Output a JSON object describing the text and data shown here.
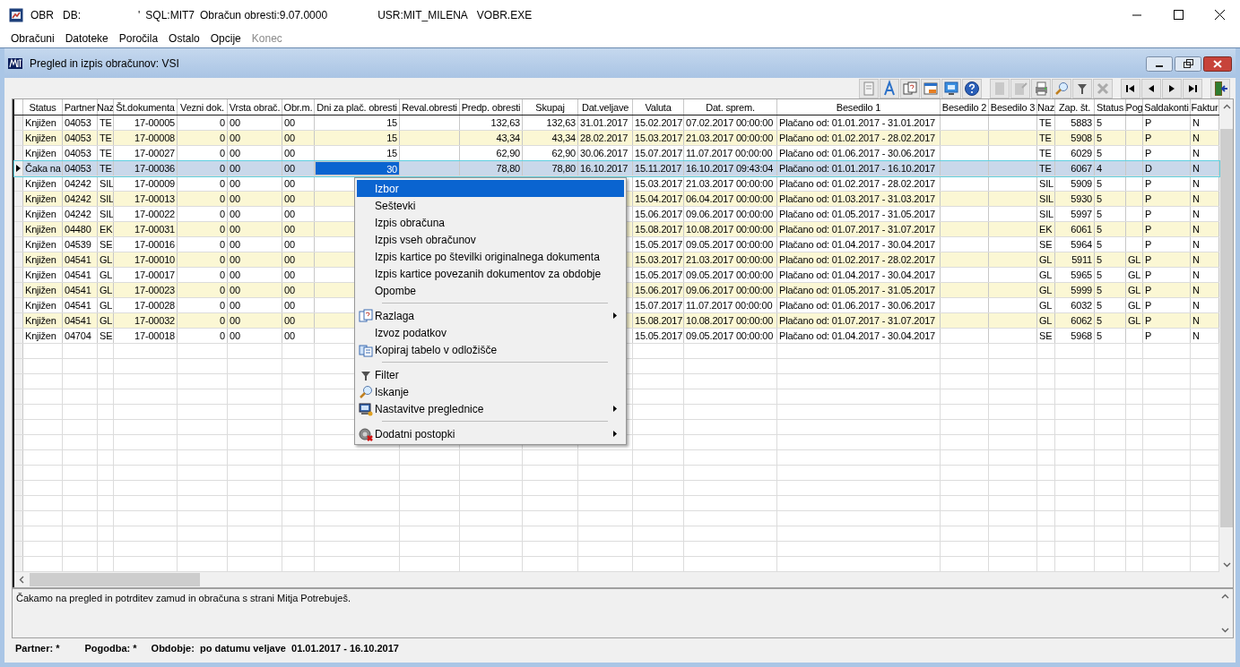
{
  "title_bar": {
    "app": "OBR",
    "parts": [
      "DB:",
      "'",
      "SQL:MIT7",
      "Obračun obresti:9.07.0000",
      "USR:MIT_MILENA",
      "VOBR.EXE"
    ]
  },
  "menu_bar": [
    {
      "label": "Obračuni",
      "disabled": false
    },
    {
      "label": "Datoteke",
      "disabled": false
    },
    {
      "label": "Poročila",
      "disabled": false
    },
    {
      "label": "Ostalo",
      "disabled": false
    },
    {
      "label": "Opcije",
      "disabled": false
    },
    {
      "label": "Konec",
      "disabled": true
    }
  ],
  "child_window": {
    "title": "Pregled in izpis obračunov:  VSI"
  },
  "table": {
    "columns": [
      {
        "label": "Status",
        "current": false
      },
      {
        "label": "Partner",
        "current": false
      },
      {
        "label": "Naz",
        "current": false
      },
      {
        "label": "Št.dokumenta",
        "current": false
      },
      {
        "label": "Vezni dok.",
        "current": false
      },
      {
        "label": "Vrsta obrač.",
        "current": false
      },
      {
        "label": "Obr.m.",
        "current": false
      },
      {
        "label": "Dni za plač. obresti",
        "current": true
      },
      {
        "label": "Reval.obresti",
        "current": false
      },
      {
        "label": "Predp. obresti",
        "current": false
      },
      {
        "label": "Skupaj",
        "current": false
      },
      {
        "label": "Dat.veljave",
        "current": false
      },
      {
        "label": "Valuta",
        "current": false
      },
      {
        "label": "Dat. sprem.",
        "current": false
      },
      {
        "label": "Besedilo 1",
        "current": false
      },
      {
        "label": "Besedilo 2",
        "current": false
      },
      {
        "label": "Besedilo 3",
        "current": false
      },
      {
        "label": "Naz",
        "current": false
      },
      {
        "label": "Zap. št.",
        "current": false
      },
      {
        "label": "Status",
        "current": false
      },
      {
        "label": "Pog",
        "current": false
      },
      {
        "label": "Saldakonti",
        "current": false
      },
      {
        "label": "Faktur",
        "current": false
      }
    ],
    "rows": [
      {
        "selected": false,
        "cells": [
          "Knjižen",
          "04053",
          "TE",
          "17-00005",
          "0",
          "00",
          "00",
          "15",
          null,
          "132,63",
          "132,63",
          "31.01.2017",
          "15.02.2017",
          "07.02.2017 00:00:00",
          "Plačano od: 01.01.2017 - 31.01.2017",
          null,
          null,
          "TE",
          "5883",
          "5",
          null,
          "P",
          "N"
        ]
      },
      {
        "selected": false,
        "cells": [
          "Knjižen",
          "04053",
          "TE",
          "17-00008",
          "0",
          "00",
          "00",
          "15",
          null,
          "43,34",
          "43,34",
          "28.02.2017",
          "15.03.2017",
          "21.03.2017 00:00:00",
          "Plačano od: 01.02.2017 - 28.02.2017",
          null,
          null,
          "TE",
          "5908",
          "5",
          null,
          "P",
          "N"
        ]
      },
      {
        "selected": false,
        "cells": [
          "Knjižen",
          "04053",
          "TE",
          "17-00027",
          "0",
          "00",
          "00",
          "15",
          null,
          "62,90",
          "62,90",
          "30.06.2017",
          "15.07.2017",
          "11.07.2017 00:00:00",
          "Plačano od: 01.06.2017 - 30.06.2017",
          null,
          null,
          "TE",
          "6029",
          "5",
          null,
          "P",
          "N"
        ]
      },
      {
        "selected": true,
        "cells": [
          "Čaka na",
          "04053",
          "TE",
          "17-00036",
          "0",
          "00",
          "00",
          "30",
          null,
          "78,80",
          "78,80",
          "16.10.2017",
          "15.11.2017",
          "16.10.2017 09:43:04",
          "Plačano od: 01.01.2017 - 16.10.2017",
          null,
          null,
          "TE",
          "6067",
          "4",
          null,
          "D",
          "N"
        ]
      },
      {
        "selected": false,
        "cells": [
          "Knjižen",
          "04242",
          "SIL",
          "17-00009",
          "0",
          "00",
          "00",
          null,
          null,
          null,
          null,
          null,
          "15.03.2017",
          "21.03.2017 00:00:00",
          "Plačano od: 01.02.2017 - 28.02.2017",
          null,
          null,
          "SIL",
          "5909",
          "5",
          null,
          "P",
          "N"
        ]
      },
      {
        "selected": false,
        "cells": [
          "Knjižen",
          "04242",
          "SIL",
          "17-00013",
          "0",
          "00",
          "00",
          null,
          null,
          null,
          null,
          null,
          "15.04.2017",
          "06.04.2017 00:00:00",
          "Plačano od: 01.03.2017 - 31.03.2017",
          null,
          null,
          "SIL",
          "5930",
          "5",
          null,
          "P",
          "N"
        ]
      },
      {
        "selected": false,
        "cells": [
          "Knjižen",
          "04242",
          "SIL",
          "17-00022",
          "0",
          "00",
          "00",
          null,
          null,
          null,
          null,
          null,
          "15.06.2017",
          "09.06.2017 00:00:00",
          "Plačano od: 01.05.2017 - 31.05.2017",
          null,
          null,
          "SIL",
          "5997",
          "5",
          null,
          "P",
          "N"
        ]
      },
      {
        "selected": false,
        "cells": [
          "Knjižen",
          "04480",
          "EK",
          "17-00031",
          "0",
          "00",
          "00",
          null,
          null,
          null,
          null,
          null,
          "15.08.2017",
          "10.08.2017 00:00:00",
          "Plačano od: 01.07.2017 - 31.07.2017",
          null,
          null,
          "EK",
          "6061",
          "5",
          null,
          "P",
          "N"
        ]
      },
      {
        "selected": false,
        "cells": [
          "Knjižen",
          "04539",
          "SE",
          "17-00016",
          "0",
          "00",
          "00",
          null,
          null,
          null,
          null,
          null,
          "15.05.2017",
          "09.05.2017 00:00:00",
          "Plačano od: 01.04.2017 - 30.04.2017",
          null,
          null,
          "SE",
          "5964",
          "5",
          null,
          "P",
          "N"
        ]
      },
      {
        "selected": false,
        "cells": [
          "Knjižen",
          "04541",
          "GL",
          "17-00010",
          "0",
          "00",
          "00",
          null,
          null,
          null,
          null,
          null,
          "15.03.2017",
          "21.03.2017 00:00:00",
          "Plačano od: 01.02.2017 - 28.02.2017",
          null,
          null,
          "GL",
          "5911",
          "5",
          "GL",
          "P",
          "N"
        ]
      },
      {
        "selected": false,
        "cells": [
          "Knjižen",
          "04541",
          "GL",
          "17-00017",
          "0",
          "00",
          "00",
          null,
          null,
          null,
          null,
          null,
          "15.05.2017",
          "09.05.2017 00:00:00",
          "Plačano od: 01.04.2017 - 30.04.2017",
          null,
          null,
          "GL",
          "5965",
          "5",
          "GL",
          "P",
          "N"
        ]
      },
      {
        "selected": false,
        "cells": [
          "Knjižen",
          "04541",
          "GL",
          "17-00023",
          "0",
          "00",
          "00",
          null,
          null,
          null,
          null,
          null,
          "15.06.2017",
          "09.06.2017 00:00:00",
          "Plačano od: 01.05.2017 - 31.05.2017",
          null,
          null,
          "GL",
          "5999",
          "5",
          "GL",
          "P",
          "N"
        ]
      },
      {
        "selected": false,
        "cells": [
          "Knjižen",
          "04541",
          "GL",
          "17-00028",
          "0",
          "00",
          "00",
          null,
          null,
          null,
          null,
          null,
          "15.07.2017",
          "11.07.2017 00:00:00",
          "Plačano od: 01.06.2017 - 30.06.2017",
          null,
          null,
          "GL",
          "6032",
          "5",
          "GL",
          "P",
          "N"
        ]
      },
      {
        "selected": false,
        "cells": [
          "Knjižen",
          "04541",
          "GL",
          "17-00032",
          "0",
          "00",
          "00",
          null,
          null,
          null,
          null,
          null,
          "15.08.2017",
          "10.08.2017 00:00:00",
          "Plačano od: 01.07.2017 - 31.07.2017",
          null,
          null,
          "GL",
          "6062",
          "5",
          "GL",
          "P",
          "N"
        ]
      },
      {
        "selected": false,
        "cells": [
          "Knjižen",
          "04704",
          "SE",
          "17-00018",
          "0",
          "00",
          "00",
          null,
          null,
          null,
          null,
          null,
          "15.05.2017",
          "09.05.2017 00:00:00",
          "Plačano od: 01.04.2017 - 30.04.2017",
          null,
          null,
          "SE",
          "5968",
          "5",
          null,
          "P",
          "N"
        ]
      }
    ]
  },
  "context_menu": [
    {
      "kind": "item",
      "label": "Izbor",
      "selected": true,
      "submenu": false
    },
    {
      "kind": "item",
      "label": "Seštevki",
      "selected": false,
      "submenu": false
    },
    {
      "kind": "item",
      "label": "Izpis obračuna",
      "selected": false,
      "submenu": false
    },
    {
      "kind": "item",
      "label": "Izpis vseh obračunov",
      "selected": false,
      "submenu": false
    },
    {
      "kind": "item",
      "label": "Izpis kartice po številki originalnega dokumenta",
      "selected": false,
      "submenu": false
    },
    {
      "kind": "item",
      "label": "Izpis kartice povezanih dokumentov za obdobje",
      "selected": false,
      "submenu": false
    },
    {
      "kind": "item",
      "label": "Opombe",
      "selected": false,
      "submenu": false
    },
    {
      "kind": "separator"
    },
    {
      "kind": "item",
      "label": "Razlaga",
      "selected": false,
      "submenu": true
    },
    {
      "kind": "item",
      "label": "Izvoz podatkov",
      "selected": false,
      "submenu": false
    },
    {
      "kind": "item",
      "label": "Kopiraj tabelo v odložišče",
      "selected": false,
      "submenu": false
    },
    {
      "kind": "separator"
    },
    {
      "kind": "item",
      "label": "Filter",
      "selected": false,
      "submenu": false
    },
    {
      "kind": "item",
      "label": "Iskanje",
      "selected": false,
      "submenu": false
    },
    {
      "kind": "item",
      "label": "Nastavitve preglednice",
      "selected": false,
      "submenu": true
    },
    {
      "kind": "separator"
    },
    {
      "kind": "item",
      "label": "Dodatni postopki",
      "selected": false,
      "submenu": true
    }
  ],
  "message": "Čakamo na pregled in potrditev zamud in obračuna s strani Mitja Potrebuješ.",
  "status_bar": [
    "Partner: *",
    "Pogodba: *",
    "Obdobje:  po datumu veljave  01.01.2017 - 16.10.2017"
  ]
}
